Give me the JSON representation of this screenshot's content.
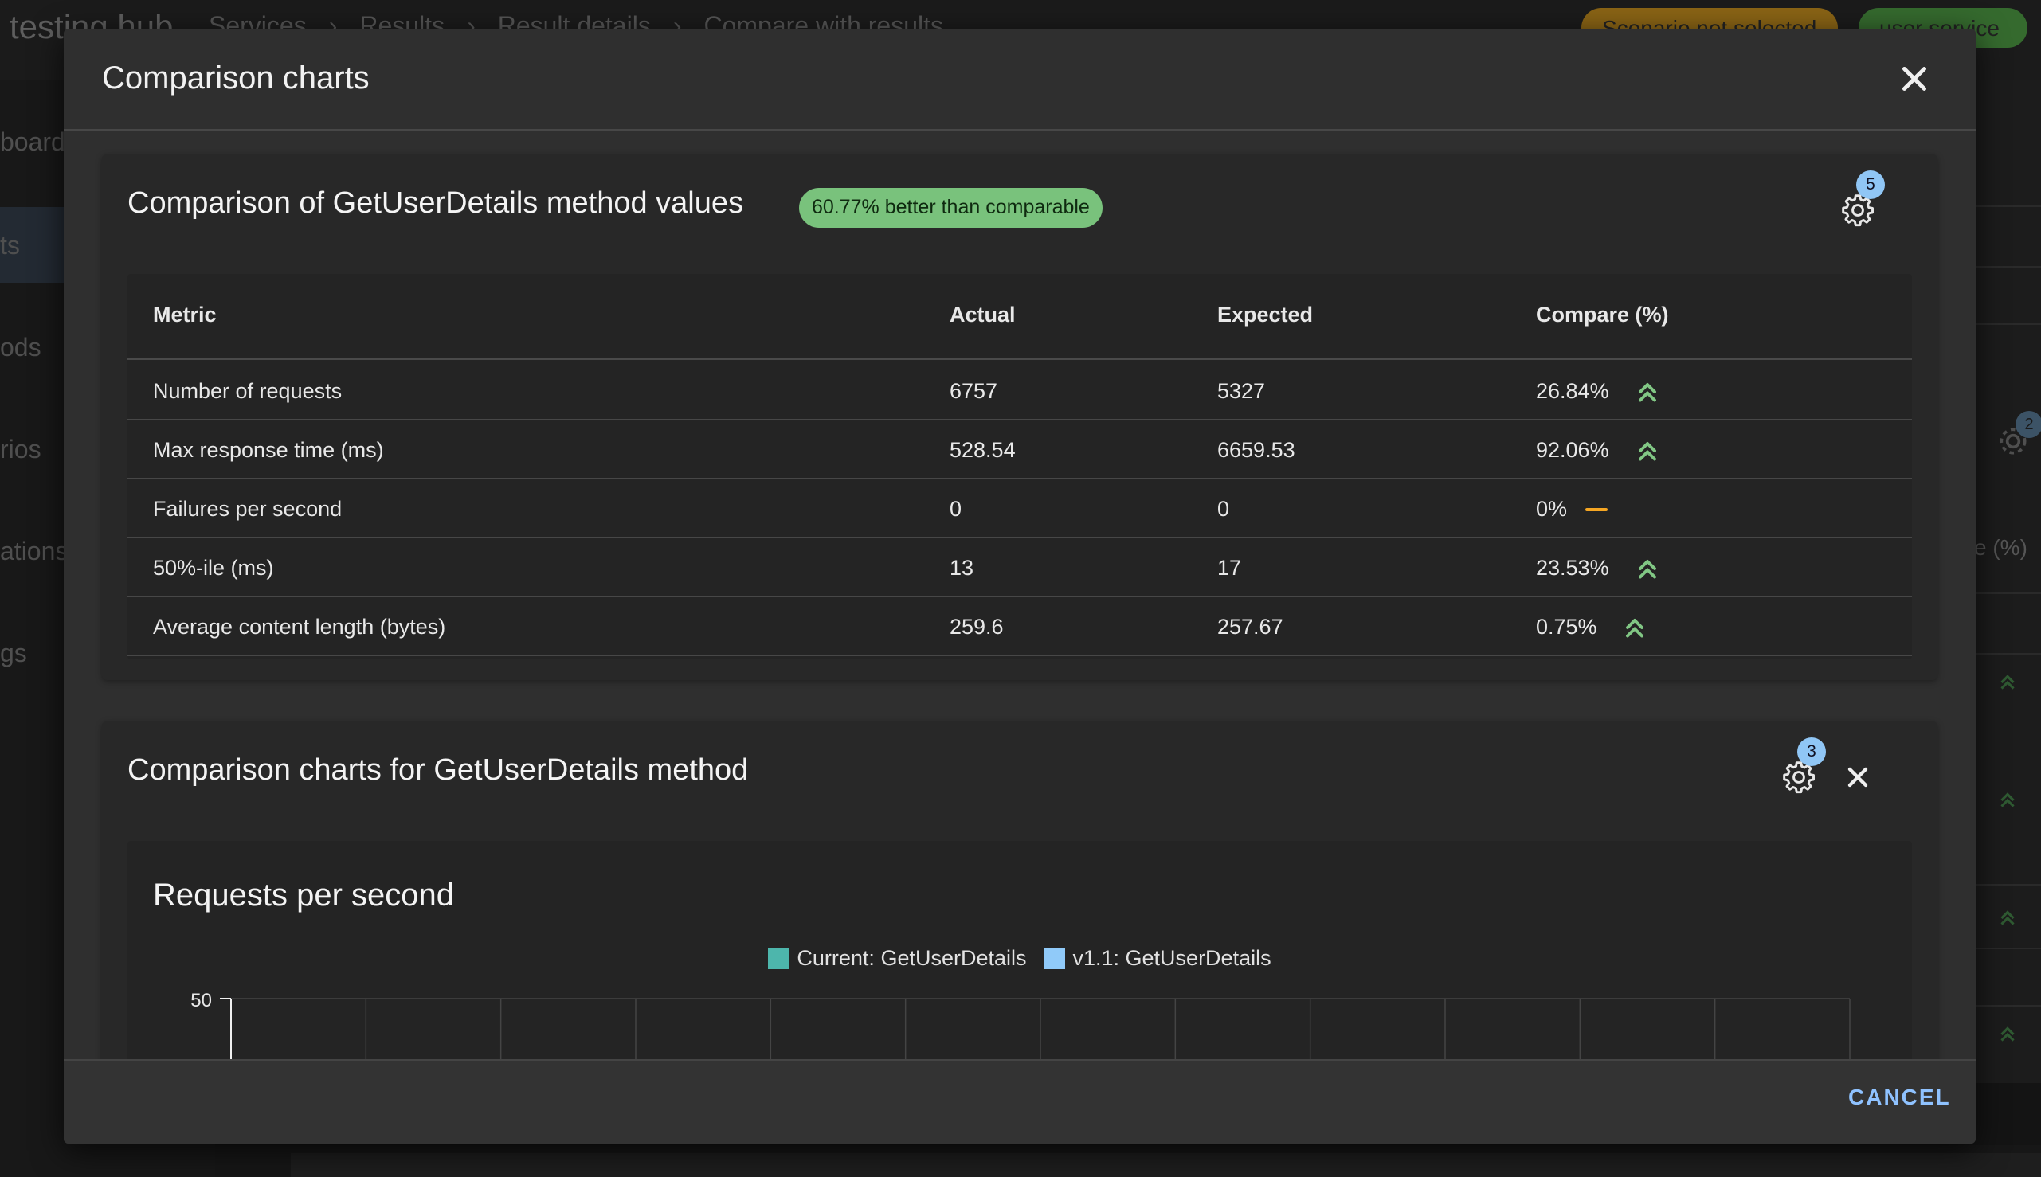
{
  "background": {
    "app_name": "testing hub",
    "breadcrumbs": [
      "Services",
      "Results",
      "Result details",
      "Compare with results"
    ],
    "chips": {
      "warning": "Scenario not selected",
      "service": "user service"
    },
    "sidebar": [
      "board",
      "ts",
      "ods",
      "rios",
      "ations",
      "gs"
    ],
    "right_panel": {
      "badge": "2",
      "header": "e (%)"
    }
  },
  "modal": {
    "title": "Comparison charts",
    "cancel_label": "CANCEL"
  },
  "values_card": {
    "title": "Comparison of GetUserDetails method values",
    "badge": "60.77% better than comparable",
    "settings_count": "5",
    "columns": {
      "metric": "Metric",
      "actual": "Actual",
      "expected": "Expected",
      "compare": "Compare (%)"
    },
    "rows": [
      {
        "metric": "Number of requests",
        "actual": "6757",
        "expected": "5327",
        "compare": "26.84%",
        "trend": "up"
      },
      {
        "metric": "Max response time (ms)",
        "actual": "528.54",
        "expected": "6659.53",
        "compare": "92.06%",
        "trend": "up"
      },
      {
        "metric": "Failures per second",
        "actual": "0",
        "expected": "0",
        "compare": "0%",
        "trend": "neutral"
      },
      {
        "metric": "50%-ile (ms)",
        "actual": "13",
        "expected": "17",
        "compare": "23.53%",
        "trend": "up"
      },
      {
        "metric": "Average content length (bytes)",
        "actual": "259.6",
        "expected": "257.67",
        "compare": "0.75%",
        "trend": "up"
      }
    ]
  },
  "charts_card": {
    "title": "Comparison charts for GetUserDetails method",
    "settings_count": "3"
  },
  "colors": {
    "current": "#4db6ac",
    "comparison": "#90caf9",
    "trend_up": "#81c784",
    "trend_neutral": "#f5a623"
  },
  "chart_data": {
    "type": "scatter",
    "title": "Requests per second",
    "ylim": [
      0,
      50
    ],
    "yticks": [
      50
    ],
    "grid": true,
    "legend_position": "top-center",
    "series": [
      {
        "name": "Current: GetUserDetails",
        "color": "#4db6ac"
      },
      {
        "name": "v1.1: GetUserDetails",
        "color": "#90caf9"
      }
    ]
  }
}
